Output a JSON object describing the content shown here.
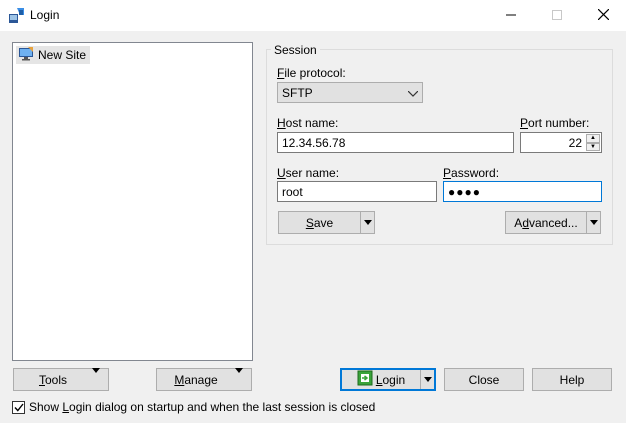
{
  "window": {
    "title": "Login",
    "app_icon": "winscp-icon",
    "minimize_icon": "minimize-icon",
    "maximize_icon": "maximize-icon",
    "close_icon": "close-icon"
  },
  "site_tree": {
    "items": [
      {
        "label": "New Site",
        "icon": "monitor-site-icon",
        "selected": true
      }
    ]
  },
  "session": {
    "group_title": "Session",
    "file_protocol": {
      "label": "File protocol:",
      "value": "SFTP"
    },
    "host_name": {
      "label": "Host name:",
      "value": "12.34.56.78"
    },
    "port_number": {
      "label": "Port number:",
      "value": "22"
    },
    "user_name": {
      "label": "User name:",
      "value": "root"
    },
    "password": {
      "label": "Password:",
      "value": "●●●●"
    },
    "save_label": "Save",
    "advanced_label": "Advanced..."
  },
  "buttons": {
    "tools": "Tools",
    "manage": "Manage",
    "login": "Login",
    "login_icon": "login-icon",
    "close": "Close",
    "help": "Help"
  },
  "startup_checkbox": {
    "label": "Show Login dialog on startup and when the last session is closed",
    "checked": true
  }
}
